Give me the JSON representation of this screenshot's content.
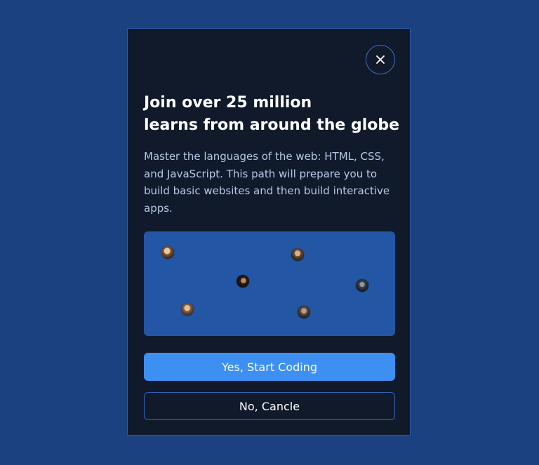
{
  "modal": {
    "title_line1": "Join over 25 million",
    "title_line2": "learns from around the globe",
    "description": "Master the languages of the web: HTML, CSS, and JavaScript. This path will prepare you to build basic websites and then build interactive apps.",
    "close_icon": "close-icon",
    "primary_label": "Yes, Start Coding",
    "secondary_label": "No, Cancle"
  },
  "colors": {
    "page_background": "#1b4181",
    "modal_background": "#111a2b",
    "panel_background": "#2456a6",
    "primary_button": "#3d8ff2",
    "border": "#2f64b8"
  }
}
